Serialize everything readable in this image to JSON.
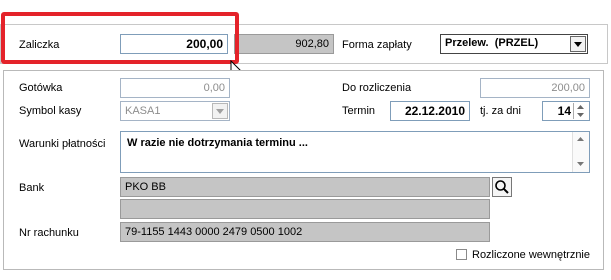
{
  "top": {
    "zaliczka_label": "Zaliczka",
    "zaliczka_value": "200,00",
    "second_value": "902,80",
    "forma_label": "Forma zapłaty",
    "forma_value": "Przelew.  (PRZEL)"
  },
  "form": {
    "gotowka_label": "Gotówka",
    "gotowka_value": "0,00",
    "do_rozliczenia_label": "Do rozliczenia",
    "do_rozliczenia_value": "200,00",
    "symbol_label": "Symbol kasy",
    "symbol_value": "KASA1",
    "termin_label": "Termin",
    "termin_value": "22.12.2010",
    "tj_label": "tj. za dni",
    "tj_value": "14",
    "warunki_label": "Warunki płatności",
    "warunki_value": "W razie nie dotrzymania terminu ...",
    "bank_label": "Bank",
    "bank_value": "PKO BB",
    "bank_extra": "",
    "nr_label": "Nr rachunku",
    "nr_value": "79-1155 1443 0000 2479 0500 1002",
    "rozliczone_label": "Rozliczone wewnętrznie"
  },
  "icons": {
    "dropdown": "chevron-down-icon",
    "search": "search-icon",
    "cursor": "mouse-pointer-icon"
  },
  "colors": {
    "highlight": "#e4232a",
    "disabled_field": "#c5c5c5"
  }
}
